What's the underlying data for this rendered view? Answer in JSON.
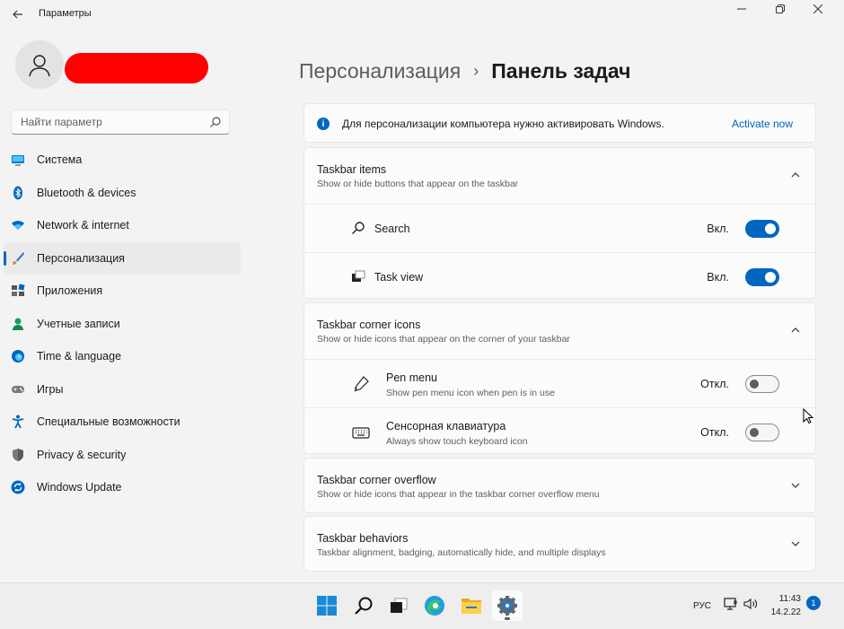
{
  "window": {
    "title": "Параметры",
    "back_icon": "arrow-left-icon",
    "minimize_icon": "minimize-icon",
    "maximize_icon": "restore-icon",
    "close_icon": "close-icon"
  },
  "profile": {
    "avatar_icon": "person-icon"
  },
  "search": {
    "placeholder": "Найти параметр",
    "icon": "search-icon"
  },
  "sidebar": {
    "items": [
      {
        "label": "Система",
        "icon": "system-display-icon",
        "color": "#0078d4"
      },
      {
        "label": "Bluetooth & devices",
        "icon": "bluetooth-icon",
        "color": "#0067c0"
      },
      {
        "label": "Network & internet",
        "icon": "wifi-icon",
        "color": "#0067c0"
      },
      {
        "label": "Персонализация",
        "icon": "paintbrush-icon",
        "color": "#c47a33",
        "active": true
      },
      {
        "label": "Приложения",
        "icon": "apps-icon",
        "color": "#6b6b6b"
      },
      {
        "label": "Учетные записи",
        "icon": "person-account-icon",
        "color": "#18a05e"
      },
      {
        "label": "Time & language",
        "icon": "globe-clock-icon",
        "color": "#0067c0"
      },
      {
        "label": "Игры",
        "icon": "gamepad-icon",
        "color": "#7a7a7a"
      },
      {
        "label": "Специальные возможности",
        "icon": "accessibility-icon",
        "color": "#0067c0"
      },
      {
        "label": "Privacy & security",
        "icon": "shield-icon",
        "color": "#7a7a7a"
      },
      {
        "label": "Windows Update",
        "icon": "update-sync-icon",
        "color": "#0067c0"
      }
    ]
  },
  "breadcrumb": {
    "parent": "Персонализация",
    "separator": "›",
    "current": "Панель задач"
  },
  "activation": {
    "text": "Для персонализации компьютера нужно активировать Windows.",
    "link": "Activate now",
    "icon": "info-icon"
  },
  "sections": {
    "taskbar_items": {
      "title": "Taskbar items",
      "subtitle": "Show or hide buttons that appear on the taskbar",
      "expanded": true,
      "rows": [
        {
          "label": "Search",
          "icon": "search-icon",
          "state": "Вкл.",
          "on": true
        },
        {
          "label": "Task view",
          "icon": "task-view-icon",
          "state": "Вкл.",
          "on": true
        }
      ]
    },
    "corner_icons": {
      "title": "Taskbar corner icons",
      "subtitle": "Show or hide icons that appear on the corner of your taskbar",
      "expanded": true,
      "rows": [
        {
          "label": "Pen menu",
          "sub": "Show pen menu icon when pen is in use",
          "icon": "pen-icon",
          "state": "Откл.",
          "on": false
        },
        {
          "label": "Сенсорная клавиатура",
          "sub": "Always show touch keyboard icon",
          "icon": "keyboard-icon",
          "state": "Откл.",
          "on": false
        }
      ]
    },
    "corner_overflow": {
      "title": "Taskbar corner overflow",
      "subtitle": "Show or hide icons that appear in the taskbar corner overflow menu",
      "expanded": false
    },
    "behaviors": {
      "title": "Taskbar behaviors",
      "subtitle": "Taskbar alignment, badging, automatically hide, and multiple displays",
      "expanded": false
    }
  },
  "taskbar": {
    "apps": [
      "windows-start-icon",
      "search-icon",
      "task-view-icon",
      "edge-browser-icon",
      "file-explorer-icon",
      "settings-gear-icon"
    ],
    "language": "РУС",
    "time": "11:43",
    "date": "14.2.22",
    "notification_count": "1"
  },
  "colors": {
    "accent": "#0067c0",
    "background": "#f3f3f3",
    "card": "#fbfbfb",
    "redaction": "#ff0000"
  }
}
